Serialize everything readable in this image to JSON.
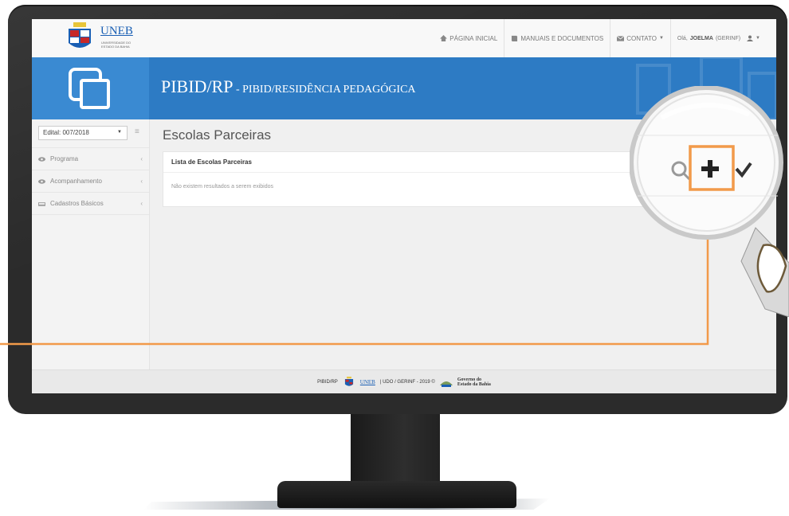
{
  "topbar": {
    "logo_text": "UNEB",
    "logo_sub": "UNIVERSIDADE DO ESTADO DA BAHIA",
    "nav": [
      {
        "icon": "home-icon",
        "label": "PÁGINA INICIAL"
      },
      {
        "icon": "book-icon",
        "label": "MANUAIS E DOCUMENTOS"
      },
      {
        "icon": "envelope-icon",
        "label": "CONTATO"
      }
    ],
    "user_greeting": "Olá, ",
    "user_name": "JOELMA",
    "user_role": " (GERINF)"
  },
  "header": {
    "title": "PIBID/RP",
    "subtitle": " - PIBID/RESIDÊNCIA PEDAGÓGICA"
  },
  "sidebar": {
    "edital_selected": "Edital: 007/2018",
    "items": [
      {
        "icon": "eye-icon",
        "label": "Programa"
      },
      {
        "icon": "eye-icon",
        "label": "Acompanhamento"
      },
      {
        "icon": "drive-icon",
        "label": "Cadastros Básicos"
      }
    ]
  },
  "main": {
    "page_title": "Escolas Parceiras",
    "panel_title": "Lista de Escolas Parceiras",
    "empty_message": "Não existem resultados a serem exibidos"
  },
  "footer": {
    "left": "PIBID/RP",
    "uneb": "UNEB",
    "credits": "| UDO / GERINF - 2019 ©",
    "gov_line1": "Governo do",
    "gov_line2": "Estado da Bahia"
  },
  "magnifier": {
    "icons": [
      "search-icon",
      "plus-icon",
      "check-icon"
    ]
  },
  "colors": {
    "accent_blue": "#2d7bc4",
    "callout_orange": "#f29a4a"
  }
}
